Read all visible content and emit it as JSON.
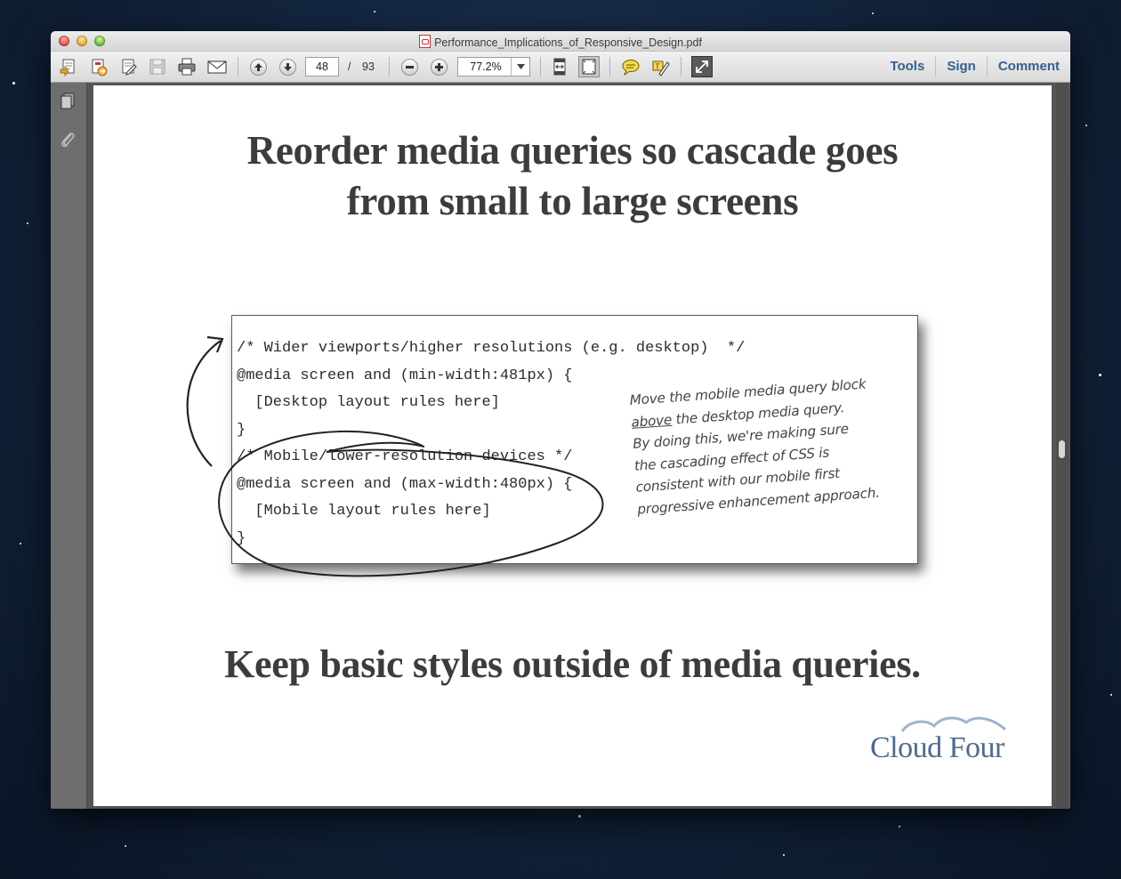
{
  "window": {
    "title": "Performance_Implications_of_Responsive_Design.pdf"
  },
  "toolbar": {
    "icons": [
      "create-pdf-icon",
      "export-pdf-icon",
      "edit-pdf-icon",
      "save-icon",
      "print-icon",
      "email-icon",
      "previous-page-icon",
      "next-page-icon",
      "zoom-out-icon",
      "zoom-in-icon",
      "fit-width-icon",
      "fit-page-icon",
      "comment-icon",
      "highlight-icon",
      "fullscreen-icon"
    ],
    "page_current": "48",
    "page_separator": "/",
    "page_total": "93",
    "zoom": "77.2%",
    "tabs": [
      {
        "label": "Tools"
      },
      {
        "label": "Sign"
      },
      {
        "label": "Comment"
      }
    ]
  },
  "sidebar": {
    "icons": [
      "page-thumbnails-icon",
      "attachments-icon"
    ]
  },
  "slide": {
    "title_line1": "Reorder media queries so cascade goes",
    "title_line2": "from small to large screens",
    "code_lines": [
      "/* Wider viewports/higher resolutions (e.g. desktop)  */",
      "@media screen and (min-width:481px) {",
      "  [Desktop layout rules here]",
      "}",
      "/* Mobile/lower-resolution devices */",
      "@media screen and (max-width:480px) {",
      "  [Mobile layout rules here]",
      "}"
    ],
    "note": {
      "line1": "Move the mobile media query block",
      "line2_underlined": "above",
      "line2_rest": " the desktop media query.",
      "line3": "By doing this, we're making sure",
      "line4": "the cascading effect of CSS is",
      "line5": "consistent with our mobile first",
      "line6": "progressive enhancement approach."
    },
    "subtitle": "Keep basic styles outside of media queries.",
    "logo_text": "Cloud Four"
  },
  "colors": {
    "link_blue": "#34608f",
    "logo_blue": "#4c6a8e",
    "heading_gray": "#3c3c3c"
  }
}
